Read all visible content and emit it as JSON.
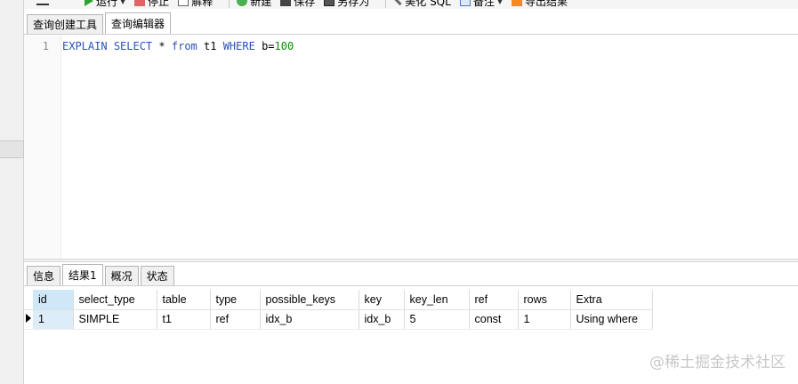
{
  "toolbar": {
    "run_label": "运行",
    "stop_label": "停止",
    "explain_label": "解释",
    "new_label": "新建",
    "save_label": "保存",
    "saveas_label": "另存为",
    "beautify_label": "美化 SQL",
    "note_label": "备注",
    "export_label": "导出结果"
  },
  "editor_tabs": [
    {
      "label": "查询创建工具"
    },
    {
      "label": "查询编辑器"
    }
  ],
  "editor": {
    "line_number": "1",
    "tokens": {
      "explain": "EXPLAIN",
      "select": "SELECT",
      "star": "*",
      "from": "from",
      "table": "t1",
      "where": "WHERE",
      "col": "b=",
      "value": "100"
    }
  },
  "result_tabs": [
    {
      "label": "信息"
    },
    {
      "label": "结果1"
    },
    {
      "label": "概况"
    },
    {
      "label": "状态"
    }
  ],
  "grid": {
    "columns": [
      "id",
      "select_type",
      "table",
      "type",
      "possible_keys",
      "key",
      "key_len",
      "ref",
      "rows",
      "Extra"
    ],
    "rows": [
      [
        "1",
        "SIMPLE",
        "t1",
        "ref",
        "idx_b",
        "idx_b",
        "5",
        "const",
        "1",
        "Using where"
      ]
    ]
  },
  "watermark": "@稀土掘金技术社区",
  "colors": {
    "keyword": "#2a52be",
    "number": "#0b8a0b",
    "selected_header": "#cfe8f8"
  }
}
